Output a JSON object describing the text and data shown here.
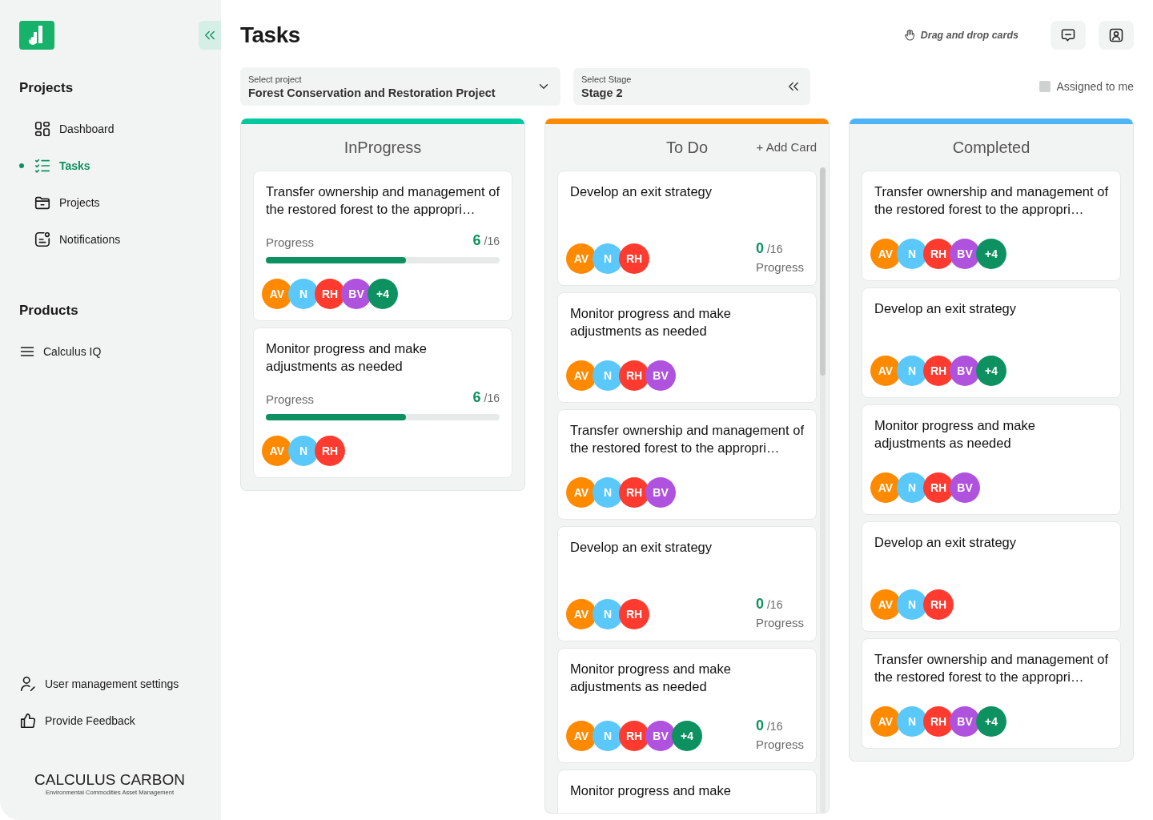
{
  "sidebar": {
    "sections": [
      {
        "heading": "Projects",
        "items": [
          {
            "label": "Dashboard",
            "selected": false
          },
          {
            "label": "Tasks",
            "selected": true
          },
          {
            "label": "Projects",
            "selected": false
          },
          {
            "label": "Notifications",
            "selected": false
          }
        ]
      },
      {
        "heading": "Products",
        "items": [
          {
            "label": "Calculus IQ",
            "selected": false
          }
        ]
      }
    ],
    "footer_items": [
      {
        "label": "User management settings"
      },
      {
        "label": "Provide Feedback"
      }
    ],
    "brand": {
      "name": "CALCULUS CARBON",
      "tagline": "Environmental Commodities Asset Management"
    }
  },
  "header": {
    "title": "Tasks",
    "hint": "Drag and drop cards"
  },
  "filters": [
    {
      "label": "Select project",
      "value": "Forest Conservation and Restoration Project"
    },
    {
      "label": "Select Stage",
      "value": "Stage 2"
    }
  ],
  "assigned_to_me": {
    "label": "Assigned to me",
    "checked": false
  },
  "columns": [
    {
      "title": "InProgress",
      "color": "#00c9a0",
      "cards": [
        {
          "kind": "bar",
          "title": "Transfer ownership and management of the restored forest to the appropri…",
          "progress_label": "Progress",
          "done": "6",
          "total": "/16",
          "level": 0.6,
          "avatars": [
            {
              "initials": "AV",
              "color": "#ff8a00"
            },
            {
              "initials": "N",
              "color": "#5ac8fa"
            },
            {
              "initials": "RH",
              "color": "#ff3b30"
            },
            {
              "initials": "BV",
              "color": "#af52de"
            },
            {
              "initials": "+4",
              "color": "#0e9160"
            }
          ]
        },
        {
          "kind": "bar",
          "title": "Monitor progress and make adjustments as needed",
          "progress_label": "Progress",
          "done": "6",
          "total": "/16",
          "level": 0.6,
          "avatars": [
            {
              "initials": "AV",
              "color": "#ff8a00"
            },
            {
              "initials": "N",
              "color": "#5ac8fa"
            },
            {
              "initials": "RH",
              "color": "#ff3b30"
            }
          ]
        }
      ]
    },
    {
      "title": "To Do",
      "color": "#ff8a00",
      "action": "+ Add Card",
      "cards": [
        {
          "kind": "counter",
          "title": "Develop an exit strategy",
          "progress_label": "Progress",
          "done": "0",
          "total": "/16",
          "avatars": [
            {
              "initials": "AV",
              "color": "#ff8a00"
            },
            {
              "initials": "N",
              "color": "#5ac8fa"
            },
            {
              "initials": "RH",
              "color": "#ff3b30"
            }
          ]
        },
        {
          "kind": "plain",
          "title": "Monitor progress and make adjustments as needed",
          "avatars": [
            {
              "initials": "AV",
              "color": "#ff8a00"
            },
            {
              "initials": "N",
              "color": "#5ac8fa"
            },
            {
              "initials": "RH",
              "color": "#ff3b30"
            },
            {
              "initials": "BV",
              "color": "#af52de"
            }
          ]
        },
        {
          "kind": "plain",
          "title": "Transfer ownership and management of the restored forest to the appropri…",
          "avatars": [
            {
              "initials": "AV",
              "color": "#ff8a00"
            },
            {
              "initials": "N",
              "color": "#5ac8fa"
            },
            {
              "initials": "RH",
              "color": "#ff3b30"
            },
            {
              "initials": "BV",
              "color": "#af52de"
            }
          ]
        },
        {
          "kind": "counter",
          "title": "Develop an exit strategy",
          "progress_label": "Progress",
          "done": "0",
          "total": "/16",
          "avatars": [
            {
              "initials": "AV",
              "color": "#ff8a00"
            },
            {
              "initials": "N",
              "color": "#5ac8fa"
            },
            {
              "initials": "RH",
              "color": "#ff3b30"
            }
          ]
        },
        {
          "kind": "counter",
          "title": "Monitor progress and make adjustments as needed",
          "progress_label": "Progress",
          "done": "0",
          "total": "/16",
          "avatars": [
            {
              "initials": "AV",
              "color": "#ff8a00"
            },
            {
              "initials": "N",
              "color": "#5ac8fa"
            },
            {
              "initials": "RH",
              "color": "#ff3b30"
            },
            {
              "initials": "BV",
              "color": "#af52de"
            },
            {
              "initials": "+4",
              "color": "#0e9160"
            }
          ]
        },
        {
          "kind": "plain",
          "title": "Monitor progress and make"
        }
      ]
    },
    {
      "title": "Completed",
      "color": "#4db5f5",
      "cards": [
        {
          "kind": "plain",
          "title": "Transfer ownership and management of the restored forest to the appropri…",
          "avatars": [
            {
              "initials": "AV",
              "color": "#ff8a00"
            },
            {
              "initials": "N",
              "color": "#5ac8fa"
            },
            {
              "initials": "RH",
              "color": "#ff3b30"
            },
            {
              "initials": "BV",
              "color": "#af52de"
            },
            {
              "initials": "+4",
              "color": "#0e9160"
            }
          ]
        },
        {
          "kind": "plain",
          "title": "Develop an exit strategy",
          "avatars": [
            {
              "initials": "AV",
              "color": "#ff8a00"
            },
            {
              "initials": "N",
              "color": "#5ac8fa"
            },
            {
              "initials": "RH",
              "color": "#ff3b30"
            },
            {
              "initials": "BV",
              "color": "#af52de"
            },
            {
              "initials": "+4",
              "color": "#0e9160"
            }
          ]
        },
        {
          "kind": "plain",
          "title": "Monitor progress and make adjustments as needed",
          "avatars": [
            {
              "initials": "AV",
              "color": "#ff8a00"
            },
            {
              "initials": "N",
              "color": "#5ac8fa"
            },
            {
              "initials": "RH",
              "color": "#ff3b30"
            },
            {
              "initials": "BV",
              "color": "#af52de"
            }
          ]
        },
        {
          "kind": "plain",
          "title": "Develop an exit strategy",
          "avatars": [
            {
              "initials": "AV",
              "color": "#ff8a00"
            },
            {
              "initials": "N",
              "color": "#5ac8fa"
            },
            {
              "initials": "RH",
              "color": "#ff3b30"
            }
          ]
        },
        {
          "kind": "plain",
          "title": "Transfer ownership and management of the restored forest to the appropri…",
          "avatars": [
            {
              "initials": "AV",
              "color": "#ff8a00"
            },
            {
              "initials": "N",
              "color": "#5ac8fa"
            },
            {
              "initials": "RH",
              "color": "#ff3b30"
            },
            {
              "initials": "BV",
              "color": "#af52de"
            },
            {
              "initials": "+4",
              "color": "#0e9160"
            }
          ]
        }
      ]
    }
  ]
}
